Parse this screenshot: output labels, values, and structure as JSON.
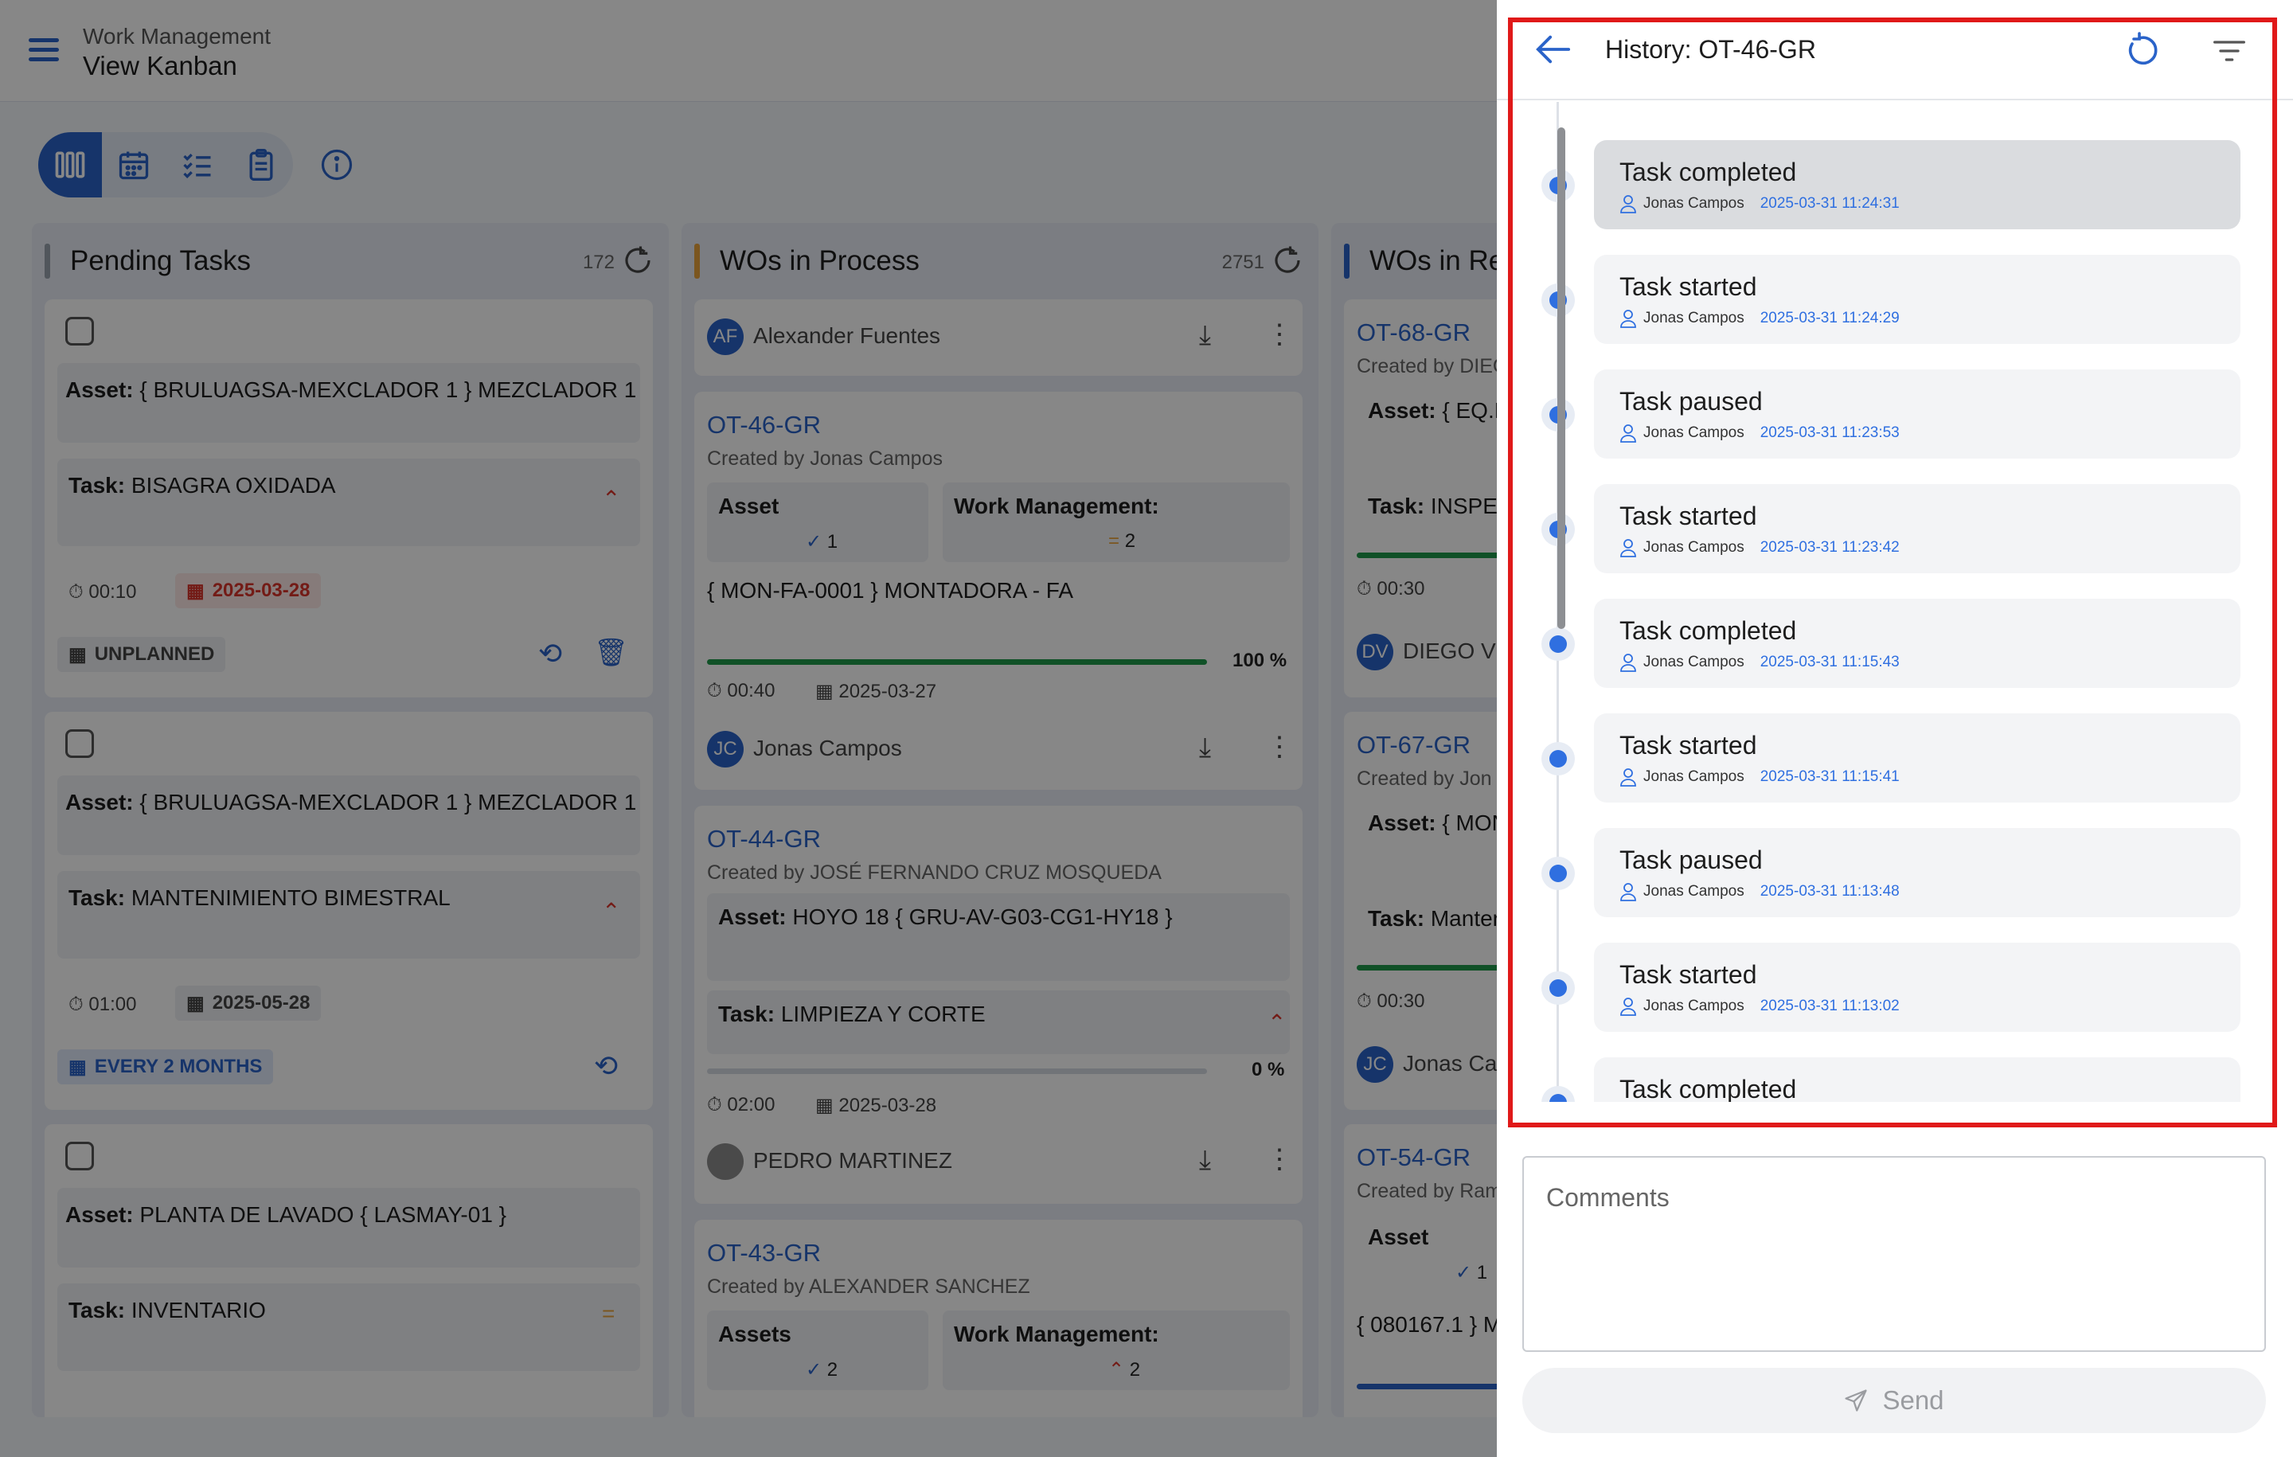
{
  "header": {
    "section": "Work Management",
    "page": "View Kanban"
  },
  "view_switcher": [
    "kanban-icon",
    "calendar-icon",
    "checklist-icon",
    "clipboard-icon"
  ],
  "columns": [
    {
      "title": "Pending Tasks",
      "count": "172",
      "accent": "#9aa3ae",
      "cards": [
        {
          "asset_label": "Asset:",
          "asset": "{ BRULUAGSA-MEXCLADOR 1 } MEZCLADOR 1",
          "task_label": "Task:",
          "task": "BISAGRA OXIDADA",
          "duration": "00:10",
          "date": "2025-03-28",
          "tag": "UNPLANNED"
        },
        {
          "asset_label": "Asset:",
          "asset": "{ BRULUAGSA-MEXCLADOR 1 } MEZCLADOR 1",
          "task_label": "Task:",
          "task": "MANTENIMIENTO BIMESTRAL",
          "duration": "01:00",
          "date": "2025-05-28",
          "tag": "EVERY 2 MONTHS"
        },
        {
          "asset_label": "Asset:",
          "asset": "PLANTA DE LAVADO { LASMAY-01 }",
          "task_label": "Task:",
          "task": "INVENTARIO"
        }
      ]
    },
    {
      "title": "WOs in Process",
      "count": "2751",
      "accent": "#e8a23b",
      "first_user": {
        "initials": "AF",
        "name": "Alexander Fuentes"
      },
      "cards": [
        {
          "id": "OT-46-GR",
          "created_by": "Created by Jonas Campos",
          "asset_label": "Asset",
          "asset_count": "1",
          "wm_label": "Work Management:",
          "wm_count": "2",
          "location": "{ MON-FA-0001 } MONTADORA - FA",
          "progress_label": "100 %",
          "progress": 100,
          "duration": "00:40",
          "date": "2025-03-27",
          "user": {
            "initials": "JC",
            "name": "Jonas Campos"
          }
        },
        {
          "id": "OT-44-GR",
          "created_by": "Created by JOSÉ FERNANDO CRUZ MOSQUEDA",
          "asset_label": "Asset:",
          "asset": "HOYO 18 { GRU-AV-G03-CG1-HY18 }",
          "task_label": "Task:",
          "task": "LIMPIEZA Y CORTE",
          "progress_label": "0 %",
          "progress": 0,
          "duration": "02:00",
          "date": "2025-03-28",
          "user": {
            "initials": "",
            "name": "PEDRO MARTINEZ"
          }
        },
        {
          "id": "OT-43-GR",
          "created_by": "Created by ALEXANDER SANCHEZ",
          "asset_label": "Assets",
          "asset_count": "2",
          "wm_label": "Work Management:",
          "wm_count": "2"
        }
      ]
    },
    {
      "title": "WOs in Re",
      "accent": "#2a63c9",
      "cards": [
        {
          "id": "OT-68-GR",
          "created_by": "Created by DIEG",
          "asset_label": "Asset:",
          "asset": "{ EQ.E",
          "task_label": "Task:",
          "task": "INSPEC",
          "duration": "00:30",
          "user": {
            "initials": "DV",
            "name": "DIEGO VE"
          }
        },
        {
          "id": "OT-67-GR",
          "created_by": "Created by Jon",
          "asset_label": "Asset:",
          "asset": "{ MON",
          "task_label": "Task:",
          "task": "Manter",
          "duration": "00:30",
          "user": {
            "initials": "JC",
            "name": "Jonas Ca"
          }
        },
        {
          "id": "OT-54-GR",
          "created_by": "Created by Ram",
          "asset_label": "Asset",
          "asset_count": "1",
          "location": "{ 080167.1 } M"
        }
      ]
    }
  ],
  "history": {
    "title": "History: OT-46-GR",
    "entries": [
      {
        "status": "Task completed",
        "user": "Jonas Campos",
        "time": "2025-03-31 11:24:31",
        "selected": true
      },
      {
        "status": "Task started",
        "user": "Jonas Campos",
        "time": "2025-03-31 11:24:29"
      },
      {
        "status": "Task paused",
        "user": "Jonas Campos",
        "time": "2025-03-31 11:23:53"
      },
      {
        "status": "Task started",
        "user": "Jonas Campos",
        "time": "2025-03-31 11:23:42"
      },
      {
        "status": "Task completed",
        "user": "Jonas Campos",
        "time": "2025-03-31 11:15:43"
      },
      {
        "status": "Task started",
        "user": "Jonas Campos",
        "time": "2025-03-31 11:15:41"
      },
      {
        "status": "Task paused",
        "user": "Jonas Campos",
        "time": "2025-03-31 11:13:48"
      },
      {
        "status": "Task started",
        "user": "Jonas Campos",
        "time": "2025-03-31 11:13:02"
      },
      {
        "status": "Task completed",
        "user": "",
        "time": ""
      }
    ],
    "comments_placeholder": "Comments",
    "send_label": "Send"
  },
  "colors": {
    "accent": "#2a63c9",
    "timeline_dot": "#2f6fe0",
    "highlight_border": "#e01919",
    "progress": "#1f9a4b"
  }
}
